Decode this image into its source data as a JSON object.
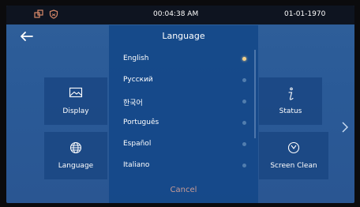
{
  "status_bar": {
    "time": "00:04:38   AM",
    "date": "01-01-1970"
  },
  "tiles": [
    {
      "label": "Display",
      "icon": "image-icon"
    },
    {
      "label": "Language",
      "icon": "globe-icon"
    },
    {
      "label": "Status",
      "icon": "info-icon"
    },
    {
      "label": "Screen Clean",
      "icon": "timer-icon"
    }
  ],
  "dialog": {
    "title": "Language",
    "options": [
      {
        "label": "English",
        "selected": true
      },
      {
        "label": "Русский",
        "selected": false
      },
      {
        "label": "한국어",
        "selected": false
      },
      {
        "label": "Português",
        "selected": false
      },
      {
        "label": "Español",
        "selected": false
      },
      {
        "label": "Italiano",
        "selected": false
      }
    ],
    "cancel_label": "Cancel"
  },
  "colors": {
    "selected_dot": "#f2d08a",
    "cancel_text": "#c79a95",
    "dialog_bg": "#154989"
  }
}
